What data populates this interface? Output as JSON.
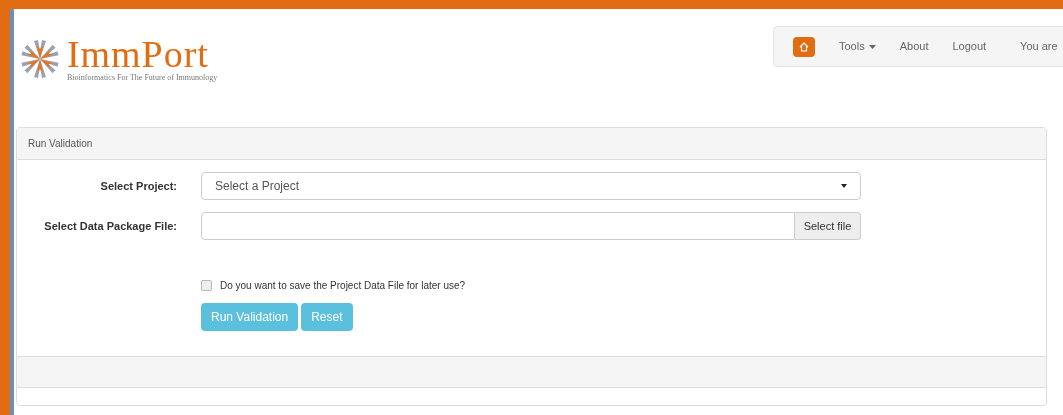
{
  "logo": {
    "title": "ImmPort",
    "tagline": "Bioinformatics For The Future of Immunology"
  },
  "nav": {
    "items": [
      {
        "label": "Tools",
        "kind": "dropdown"
      },
      {
        "label": "About",
        "kind": "link"
      },
      {
        "label": "Logout",
        "kind": "link"
      },
      {
        "label": "You are",
        "kind": "text"
      }
    ]
  },
  "panel": {
    "title": "Run Validation",
    "project": {
      "label": "Select Project:",
      "value": "Select a Project"
    },
    "file": {
      "label": "Select Data Package File:",
      "button": "Select file"
    },
    "save_option": {
      "label": "Do you want to save the Project Data File for later use?",
      "checked": false
    },
    "buttons": [
      "Run Validation",
      "Reset"
    ]
  }
}
